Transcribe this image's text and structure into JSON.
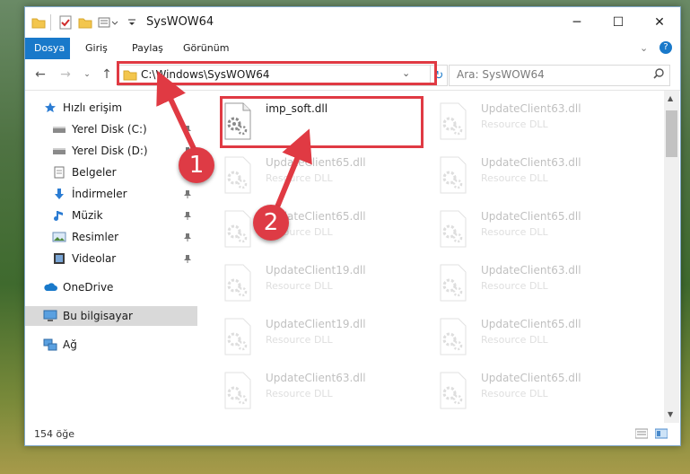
{
  "window": {
    "title": "SysWOW64",
    "controls": {
      "minimize": "─",
      "maximize": "☐",
      "close": "✕"
    }
  },
  "ribbon": {
    "tabs": [
      {
        "label": "Dosya",
        "active": true
      },
      {
        "label": "Giriş",
        "active": false
      },
      {
        "label": "Paylaş",
        "active": false
      },
      {
        "label": "Görünüm",
        "active": false
      }
    ]
  },
  "address": {
    "path": "C:\\Windows\\SysWOW64",
    "search_placeholder": "Ara: SysWOW64"
  },
  "nav": {
    "items": [
      {
        "label": "Hızlı erişim",
        "icon": "star-icon",
        "pinned": false,
        "selected": false
      },
      {
        "label": "Yerel Disk (C:)",
        "icon": "drive-icon",
        "pinned": true,
        "selected": false
      },
      {
        "label": "Yerel Disk (D:)",
        "icon": "drive-icon",
        "pinned": true,
        "selected": false
      },
      {
        "label": "Belgeler",
        "icon": "documents-icon",
        "pinned": true,
        "selected": false
      },
      {
        "label": "İndirmeler",
        "icon": "download-icon",
        "pinned": true,
        "selected": false
      },
      {
        "label": "Müzik",
        "icon": "music-icon",
        "pinned": true,
        "selected": false
      },
      {
        "label": "Resimler",
        "icon": "pictures-icon",
        "pinned": true,
        "selected": false
      },
      {
        "label": "Videolar",
        "icon": "videos-icon",
        "pinned": true,
        "selected": false
      },
      {
        "label": "OneDrive",
        "icon": "cloud-icon",
        "pinned": false,
        "selected": false
      },
      {
        "label": "Bu bilgisayar",
        "icon": "computer-icon",
        "pinned": false,
        "selected": true
      },
      {
        "label": "Ağ",
        "icon": "network-icon",
        "pinned": false,
        "selected": false
      }
    ]
  },
  "files": [
    {
      "name": "imp_soft.dll",
      "type": "",
      "highlighted": true
    },
    {
      "name": "UpdateClient63.dll",
      "type": "Resource DLL"
    },
    {
      "name": "UpdateClient65.dll",
      "type": "Resource DLL"
    },
    {
      "name": "UpdateClient63.dll",
      "type": "Resource DLL"
    },
    {
      "name": "UpdateClient65.dll",
      "type": "Resource DLL"
    },
    {
      "name": "UpdateClient65.dll",
      "type": "Resource DLL"
    },
    {
      "name": "UpdateClient19.dll",
      "type": "Resource DLL"
    },
    {
      "name": "UpdateClient63.dll",
      "type": "Resource DLL"
    },
    {
      "name": "UpdateClient19.dll",
      "type": "Resource DLL"
    },
    {
      "name": "UpdateClient65.dll",
      "type": "Resource DLL"
    },
    {
      "name": "UpdateClient63.dll",
      "type": "Resource DLL"
    },
    {
      "name": "UpdateClient65.dll",
      "type": "Resource DLL"
    }
  ],
  "status": {
    "count": "154 öğe"
  },
  "annotations": {
    "step1": "1",
    "step2": "2",
    "color": "#e03a43"
  }
}
